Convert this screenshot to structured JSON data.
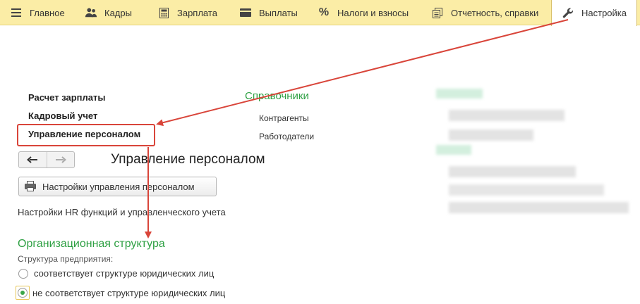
{
  "menu": {
    "items": [
      {
        "label": "Главное",
        "icon": "hamburger-icon"
      },
      {
        "label": "Кадры",
        "icon": "users-icon"
      },
      {
        "label": "Зарплата",
        "icon": "calculator-icon"
      },
      {
        "label": "Выплаты",
        "icon": "wallet-icon"
      },
      {
        "label": "Налоги и взносы",
        "icon": "percent-icon"
      },
      {
        "label": "Отчетность, справки",
        "icon": "documents-icon"
      },
      {
        "label": "Настройка",
        "icon": "wrench-icon"
      }
    ]
  },
  "sections": {
    "items": [
      {
        "label": "Расчет зарплаты"
      },
      {
        "label": "Кадровый учет"
      },
      {
        "label": "Управление персоналом"
      }
    ]
  },
  "directories": {
    "title": "Справочники",
    "items": [
      {
        "label": "Контрагенты"
      },
      {
        "label": "Работодатели"
      }
    ]
  },
  "page": {
    "title": "Управление персоналом",
    "settings_button": "Настройки управления персоналом",
    "description": "Настройки HR функций и управленческого учета"
  },
  "org": {
    "title": "Организационная структура",
    "structure_label": "Структура предприятия:",
    "options": [
      {
        "label": "соответствует структуре юридических лиц",
        "checked": false
      },
      {
        "label": "не соответствует структуре юридических лиц",
        "checked": true
      }
    ]
  },
  "colors": {
    "menubar": "#fbeda6",
    "accent_green": "#2ea043",
    "annotation_red": "#d9453a"
  }
}
